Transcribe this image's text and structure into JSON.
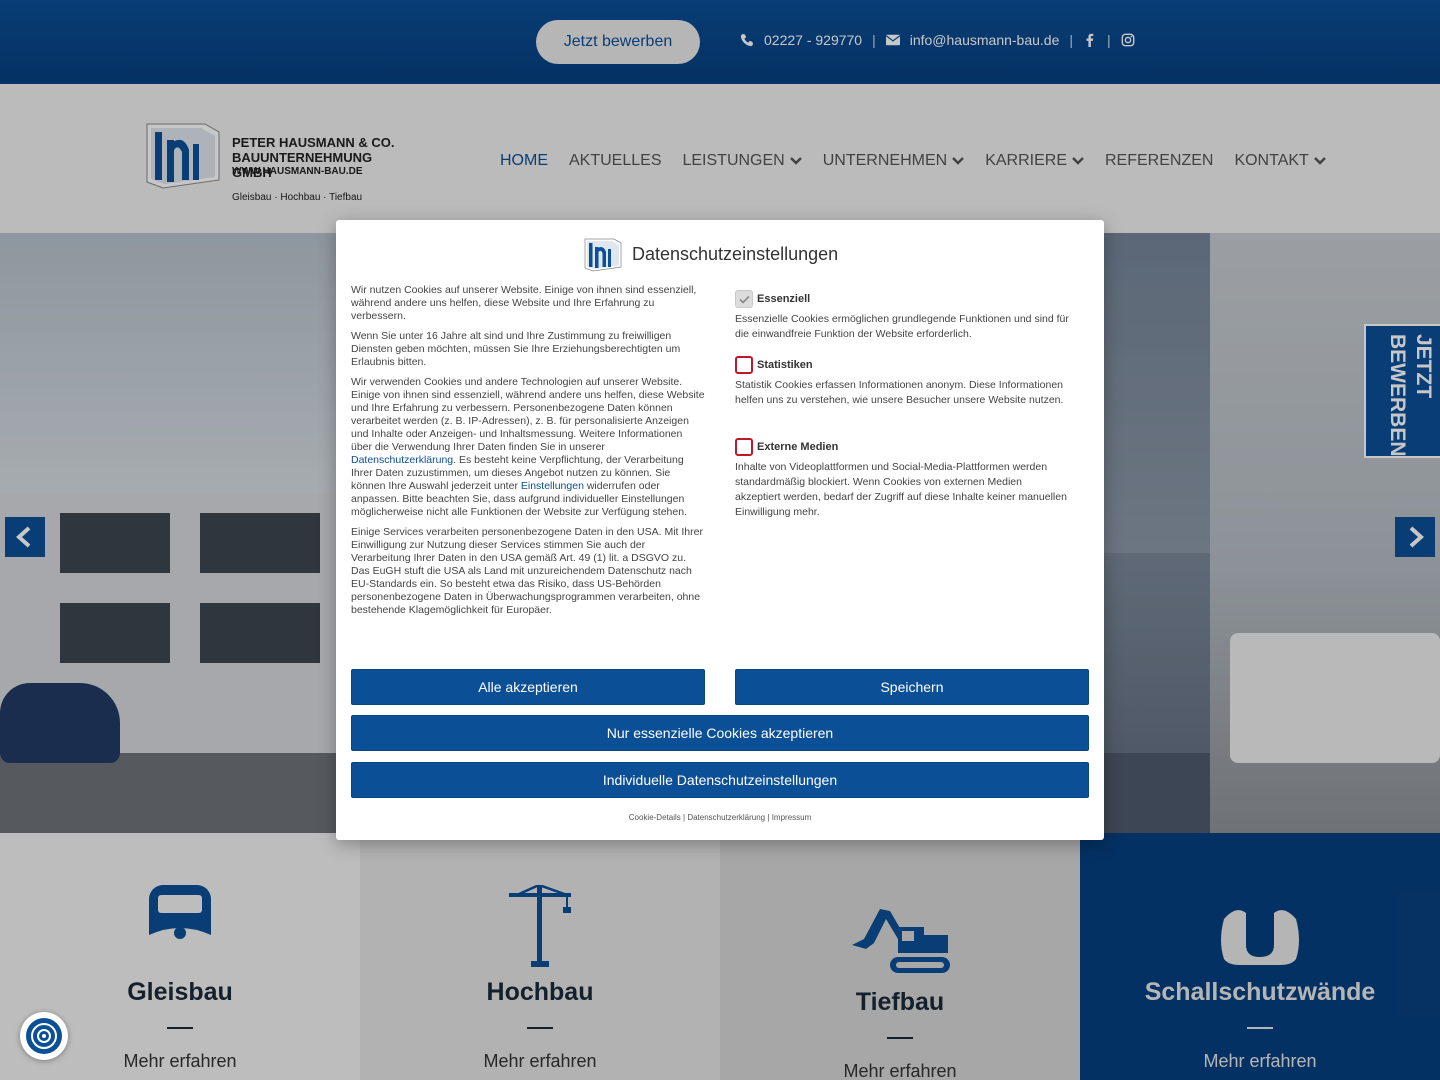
{
  "topbar": {
    "apply_button": "Jetzt bewerben",
    "phone": "02227 - 929770",
    "email": "info@hausmann-bau.de",
    "separator": "|"
  },
  "logo": {
    "name_line1": "PETER HAUSMANN & CO.",
    "name_line2": "BAUUNTERNEHMUNG GMBH",
    "website": "WWW.HAUSMANN-BAU.DE",
    "tagline": "Gleisbau · Hochbau · Tiefbau"
  },
  "nav": {
    "items": [
      {
        "label": "HOME",
        "active": true,
        "dropdown": false
      },
      {
        "label": "AKTUELLES",
        "active": false,
        "dropdown": false
      },
      {
        "label": "LEISTUNGEN",
        "active": false,
        "dropdown": true
      },
      {
        "label": "UNTERNEHMEN",
        "active": false,
        "dropdown": true
      },
      {
        "label": "KARRIERE",
        "active": false,
        "dropdown": true
      },
      {
        "label": "REFERENZEN",
        "active": false,
        "dropdown": false
      },
      {
        "label": "KONTAKT",
        "active": false,
        "dropdown": true
      }
    ]
  },
  "hero": {
    "side_tab_line1": "JETZT",
    "side_tab_line2": "BEWERBEN"
  },
  "services": [
    {
      "title": "Gleisbau",
      "link": "Mehr erfahren",
      "icon": "train-icon"
    },
    {
      "title": "Hochbau",
      "link": "Mehr erfahren",
      "icon": "crane-icon"
    },
    {
      "title": "Tiefbau",
      "link": "Mehr erfahren",
      "icon": "excavator-icon"
    },
    {
      "title": "Schallschutzwände",
      "link": "Mehr erfahren",
      "icon": "noise-barrier-icon"
    }
  ],
  "modal": {
    "title": "Datenschutzeinstellungen",
    "p1": "Wir nutzen Cookies auf unserer Website. Einige von ihnen sind essenziell, während andere uns helfen, diese Website und Ihre Erfahrung zu verbessern.",
    "p2": "Wenn Sie unter 16 Jahre alt sind und Ihre Zustimmung zu freiwilligen Diensten geben möchten, müssen Sie Ihre Erziehungsberechtigten um Erlaubnis bitten.",
    "p3a": "Wir verwenden Cookies und andere Technologien auf unserer Website. Einige von ihnen sind essenziell, während andere uns helfen, diese Website und Ihre Erfahrung zu verbessern. Personenbezogene Daten können verarbeitet werden (z. B. IP-Adressen), z. B. für personalisierte Anzeigen und Inhalte oder Anzeigen- und Inhaltsmessung. Weitere Informationen über die Verwendung Ihrer Daten finden Sie in unserer ",
    "p3_link1": "Datenschutzerklärung",
    "p3b": ". Es besteht keine Verpflichtung, der Verarbeitung Ihrer Daten zuzustimmen, um dieses Angebot nutzen zu können. Sie können Ihre Auswahl jederzeit unter ",
    "p3_link2": "Einstellungen",
    "p3c": " widerrufen oder anpassen. Bitte beachten Sie, dass aufgrund individueller Einstellungen möglicherweise nicht alle Funktionen der Website zur Verfügung stehen.",
    "p4": "Einige Services verarbeiten personenbezogene Daten in den USA. Mit Ihrer Einwilligung zur Nutzung dieser Services stimmen Sie auch der Verarbeitung Ihrer Daten in den USA gemäß Art. 49 (1) lit. a DSGVO zu. Das EuGH stuft die USA als Land mit unzureichendem Datenschutz nach EU-Standards ein. So besteht etwa das Risiko, dass US-Behörden personenbezogene Daten in Überwachungsprogrammen verarbeiten, ohne bestehende Klagemöglichkeit für Europäer.",
    "categories": [
      {
        "label": "Essenziell",
        "checked": true,
        "desc": "Essenzielle Cookies ermöglichen grundlegende Funktionen und sind für die einwandfreie Funktion der Website erforderlich."
      },
      {
        "label": "Statistiken",
        "checked": false,
        "desc": "Statistik Cookies erfassen Informationen anonym. Diese Informationen helfen uns zu verstehen, wie unsere Besucher unsere Website nutzen."
      },
      {
        "label": "Externe Medien",
        "checked": false,
        "desc": "Inhalte von Videoplattformen und Social-Media-Plattformen werden standardmäßig blockiert. Wenn Cookies von externen Medien akzeptiert werden, bedarf der Zugriff auf diese Inhalte keiner manuellen Einwilligung mehr."
      }
    ],
    "btn_accept_all": "Alle akzeptieren",
    "btn_save": "Speichern",
    "btn_essential_only": "Nur essenzielle Cookies akzeptieren",
    "btn_individual": "Individuelle Datenschutzeinstellungen",
    "footer_cookie_details": "Cookie-Details",
    "footer_privacy": "Datenschutzerklärung",
    "footer_imprint": "Impressum",
    "footer_sep": "|"
  },
  "colors": {
    "brand_blue": "#0b4f97",
    "header_gray": "#f0f0f0",
    "tile_dark": "#063f7f",
    "checkbox_red": "#c0182b"
  }
}
